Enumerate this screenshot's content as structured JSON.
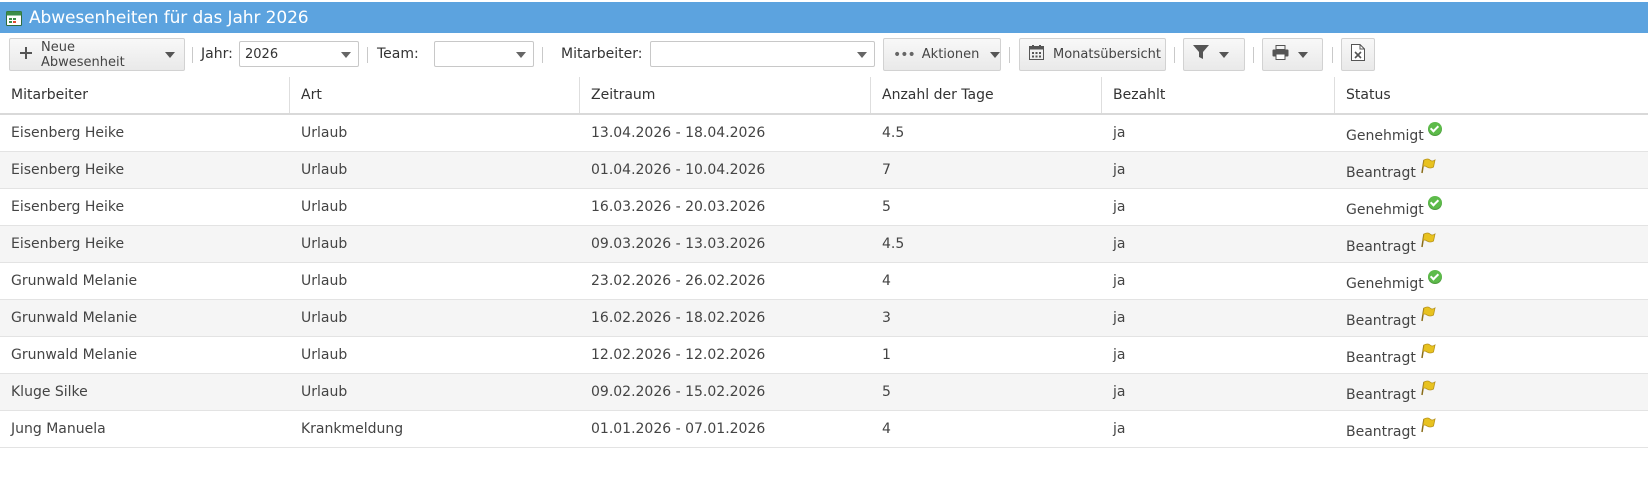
{
  "window": {
    "title": "Abwesenheiten für das Jahr 2026",
    "accent_color": "#5ca3df"
  },
  "toolbar": {
    "new_absence_label": "Neue Abwesenheit",
    "year_label": "Jahr:",
    "year_value": "2026",
    "team_label": "Team:",
    "team_value": "",
    "employee_label": "Mitarbeiter:",
    "employee_value": "",
    "actions_label": "Aktionen",
    "month_overview_label": "Monatsübersicht",
    "icons": [
      "plus-icon",
      "filter-icon",
      "print-icon",
      "excel-export-icon",
      "calendar-icon",
      "ellipsis-icon"
    ]
  },
  "table": {
    "columns": [
      "Mitarbeiter",
      "Art",
      "Zeitraum",
      "Anzahl der Tage",
      "Bezahlt",
      "Status"
    ],
    "rows": [
      {
        "employee": "Eisenberg Heike",
        "type": "Urlaub",
        "period": "13.04.2026 - 18.04.2026",
        "days": "4.5",
        "paid": "ja",
        "status": "Genehmigt",
        "status_icon": "approved-check-icon"
      },
      {
        "employee": "Eisenberg Heike",
        "type": "Urlaub",
        "period": "01.04.2026 - 10.04.2026",
        "days": "7",
        "paid": "ja",
        "status": "Beantragt",
        "status_icon": "requested-flag-icon"
      },
      {
        "employee": "Eisenberg Heike",
        "type": "Urlaub",
        "period": "16.03.2026 - 20.03.2026",
        "days": "5",
        "paid": "ja",
        "status": "Genehmigt",
        "status_icon": "approved-check-icon"
      },
      {
        "employee": "Eisenberg Heike",
        "type": "Urlaub",
        "period": "09.03.2026 - 13.03.2026",
        "days": "4.5",
        "paid": "ja",
        "status": "Beantragt",
        "status_icon": "requested-flag-icon"
      },
      {
        "employee": "Grunwald Melanie",
        "type": "Urlaub",
        "period": "23.02.2026 - 26.02.2026",
        "days": "4",
        "paid": "ja",
        "status": "Genehmigt",
        "status_icon": "approved-check-icon"
      },
      {
        "employee": "Grunwald Melanie",
        "type": "Urlaub",
        "period": "16.02.2026 - 18.02.2026",
        "days": "3",
        "paid": "ja",
        "status": "Beantragt",
        "status_icon": "requested-flag-icon"
      },
      {
        "employee": "Grunwald Melanie",
        "type": "Urlaub",
        "period": "12.02.2026 - 12.02.2026",
        "days": "1",
        "paid": "ja",
        "status": "Beantragt",
        "status_icon": "requested-flag-icon"
      },
      {
        "employee": "Kluge Silke",
        "type": "Urlaub",
        "period": "09.02.2026 - 15.02.2026",
        "days": "5",
        "paid": "ja",
        "status": "Beantragt",
        "status_icon": "requested-flag-icon"
      },
      {
        "employee": "Jung Manuela",
        "type": "Krankmeldung",
        "period": "01.01.2026 - 07.01.2026",
        "days": "4",
        "paid": "ja",
        "status": "Beantragt",
        "status_icon": "requested-flag-icon"
      }
    ]
  },
  "colors": {
    "row_alt": "#f5f5f5",
    "approved": "#5dbb4a",
    "requested": "#e8c21f"
  }
}
